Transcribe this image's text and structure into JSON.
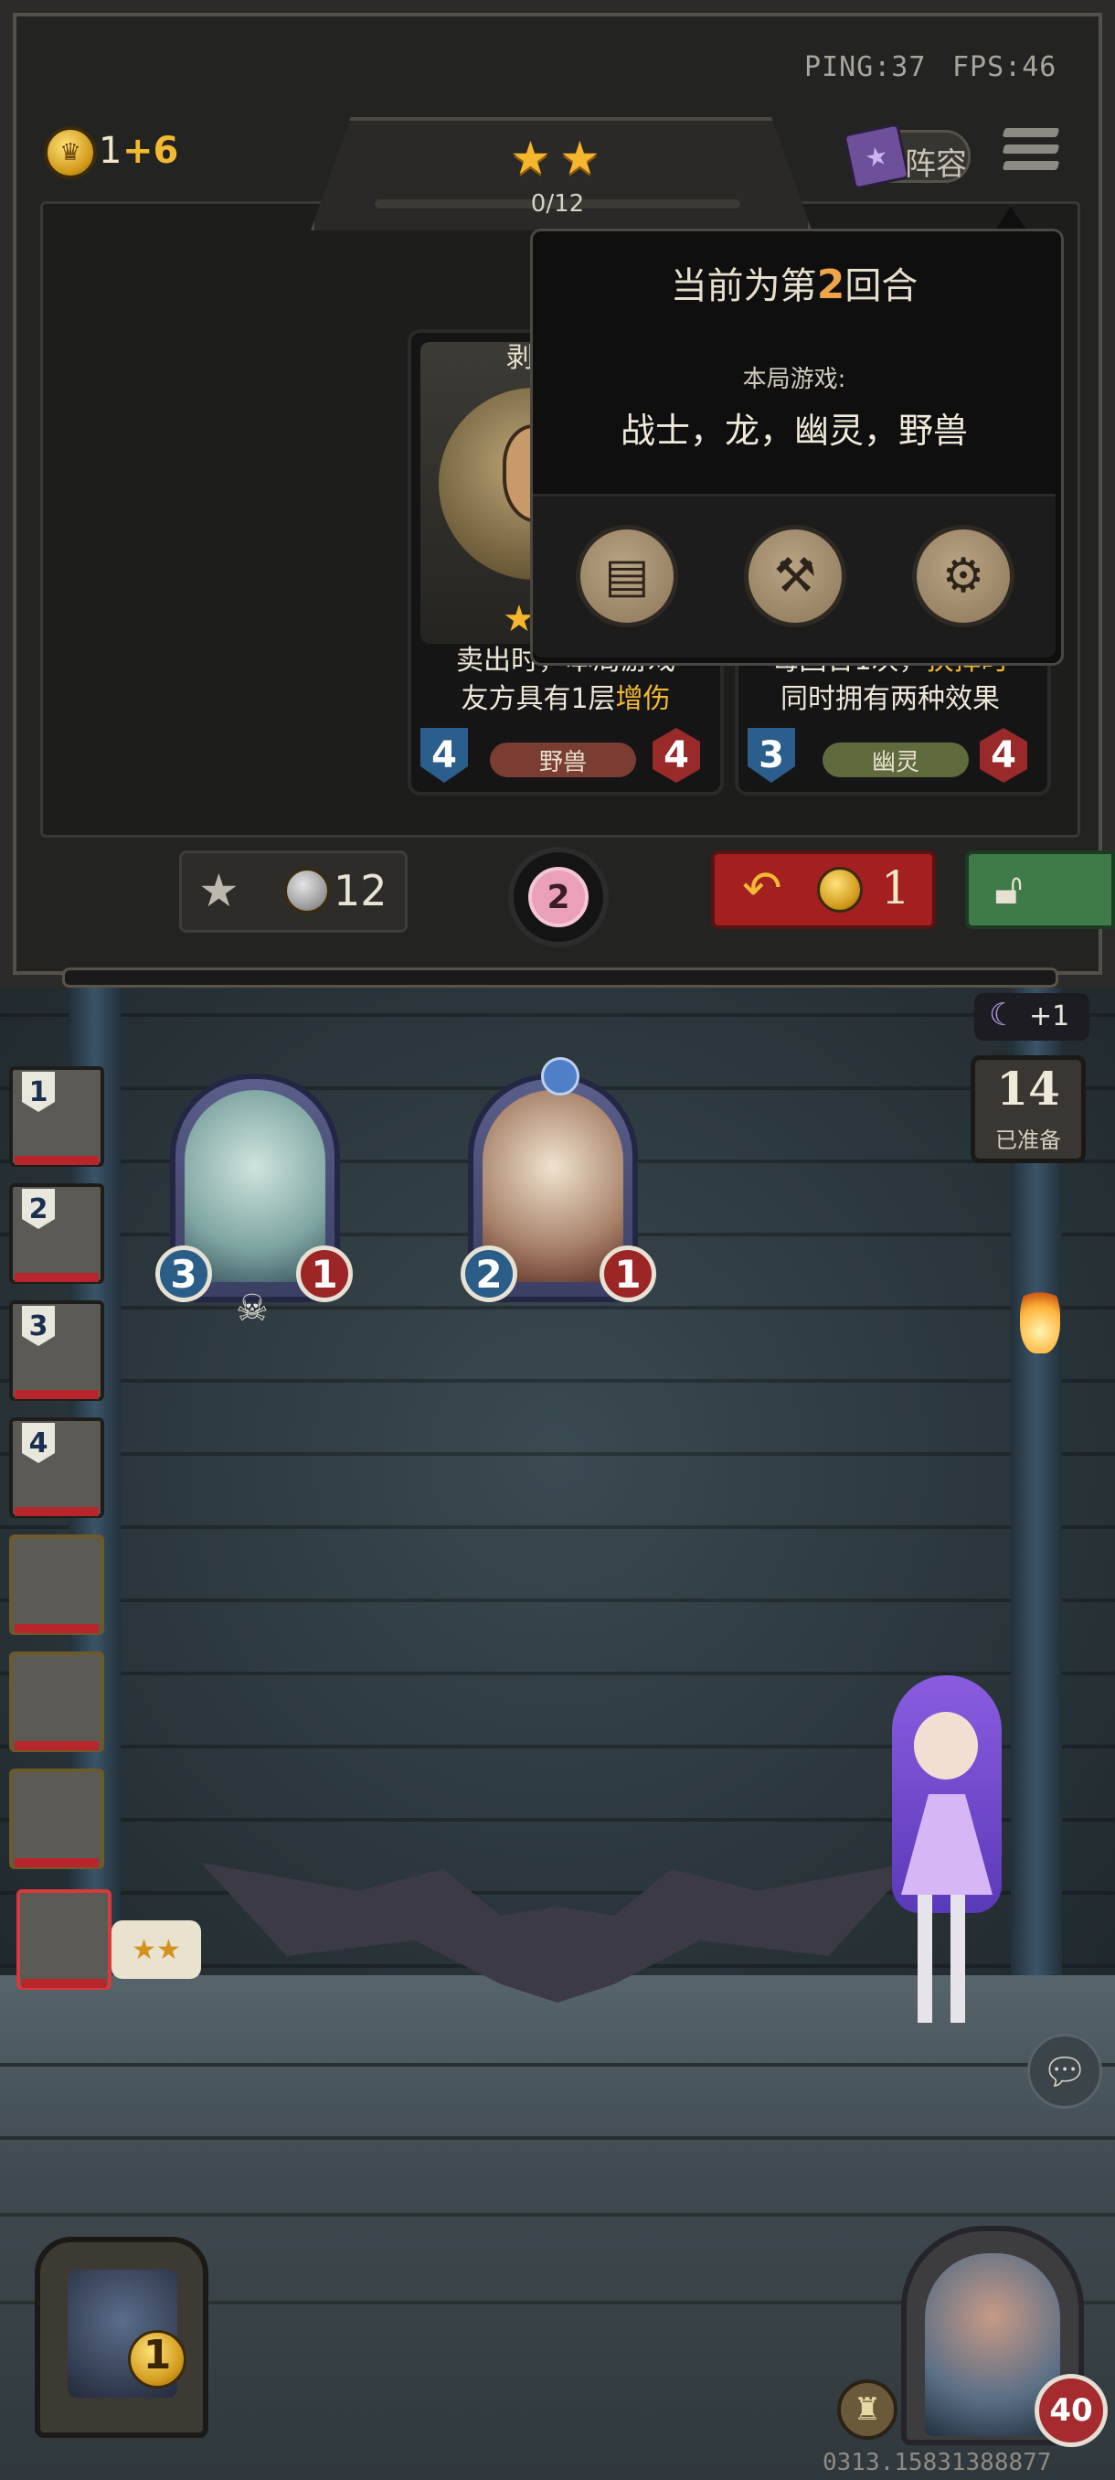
{
  "status": {
    "ping": "PING:37",
    "fps": "FPS:46"
  },
  "economy": {
    "gold": "1",
    "income": "+6"
  },
  "tier": {
    "stars": 2,
    "progress_text": "0/12",
    "star_glyph": "★"
  },
  "lineup_button": {
    "label": "阵容"
  },
  "cards": [
    {
      "name": "剥",
      "description_line1": "卖出时，本局游戏",
      "description_line2_plain": "友方具有1层",
      "description_line2_highlight": "增伤",
      "attack": "4",
      "health": "4",
      "tribe": "野兽",
      "tribe_color": "#7a3d31"
    },
    {
      "name": "",
      "description_line1_plain": "每回合1次，",
      "description_line1_highlight": "抉择时",
      "description_line2": "同时拥有两种效果",
      "attack": "3",
      "health": "4",
      "tribe": "幽灵",
      "tribe_color": "#5f6b3d"
    }
  ],
  "popup": {
    "round_prefix": "当前为第",
    "round_number": "2",
    "round_suffix": "回合",
    "game_title": "本局游戏:",
    "tribes_text": "战士，龙，幽灵，野兽",
    "buttons": [
      "book-icon",
      "cannon-icon",
      "gear-icon"
    ]
  },
  "controls": {
    "upgrade_cost": "12",
    "timer_value": "2",
    "refresh_cost": "1",
    "freeze_icon": "lock-icon"
  },
  "ready": {
    "plus": "+1",
    "count": "14",
    "label": "已准备"
  },
  "board_minions": [
    {
      "name": "fish-minion",
      "attack": "3",
      "health": "1"
    },
    {
      "name": "chef-minion",
      "attack": "2",
      "health": "1"
    }
  ],
  "queue": [
    {
      "num": "1"
    },
    {
      "num": "2"
    },
    {
      "num": "3"
    },
    {
      "num": "4"
    },
    {
      "num": ""
    },
    {
      "num": ""
    },
    {
      "num": ""
    },
    {
      "num": ""
    }
  ],
  "queue_current_badge": "★★",
  "opponent": {
    "gold": "1"
  },
  "player_hero": {
    "health": "40"
  },
  "footer": {
    "id": "0313.15831388877"
  },
  "colors": {
    "accent_gold": "#f2b933",
    "accent_red": "#a31f20",
    "accent_green": "#3f7a49",
    "highlight_orange": "#f0a44a"
  }
}
